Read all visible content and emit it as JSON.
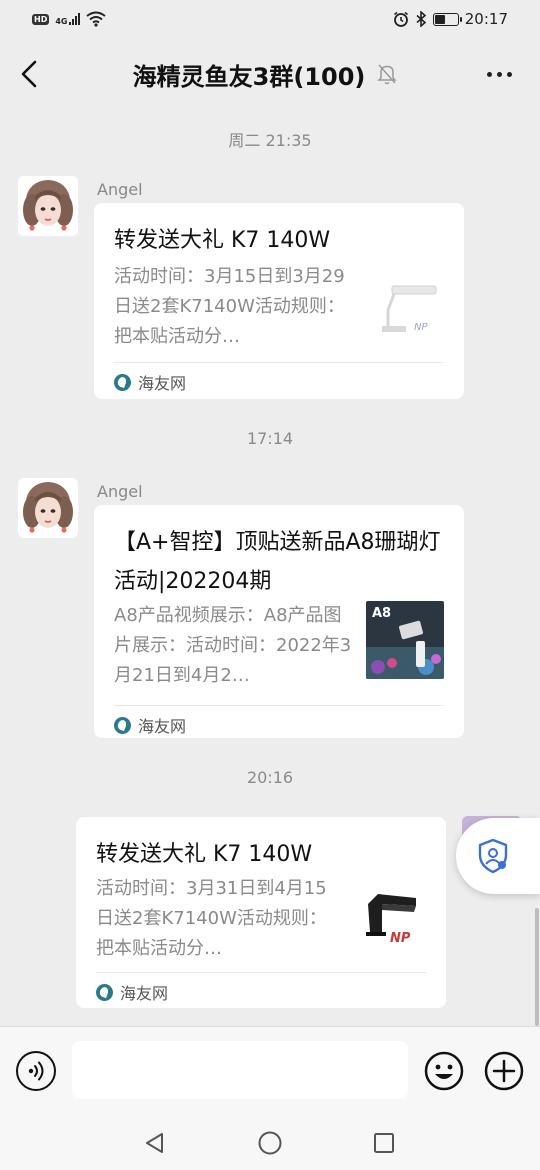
{
  "status_bar": {
    "hd": "HD",
    "network": "4G",
    "time": "20:17"
  },
  "header": {
    "title": "海精灵鱼友3群(100)",
    "icons": [
      "back-arrow-icon",
      "mute-bell-icon",
      "more-icon"
    ]
  },
  "messages": [
    {
      "time": "周二 21:35",
      "sender": "Angel",
      "title": "转发送大礼  K7 140W",
      "description": "活动时间：3月15日到3月29日送2套K7140W活动规则：把本贴活动分…",
      "source": "海友网",
      "thumbnail": "aquarium-light-white-image"
    },
    {
      "time": "17:14",
      "sender": "Angel",
      "title": "【A+智控】顶贴送新品A8珊瑚灯活动|202204期",
      "description": "A8产品视频展示：A8产品图片展示：活动时间：2022年3月21日到4月2…",
      "source": "海友网",
      "thumbnail": "a8-coral-light-poster",
      "thumbnail_label": "A8"
    },
    {
      "time": "20:16",
      "title": "转发送大礼 K7 140W",
      "description": "活动时间：3月31日到4月15日送2套K7140W活动规则：把本贴活动分…",
      "source": "海友网",
      "thumbnail": "aquarium-light-black-image"
    }
  ],
  "input_bar": {
    "placeholder": "",
    "icons": [
      "voice-icon",
      "emoji-icon",
      "plus-icon"
    ]
  },
  "nav_bar": {
    "icons": [
      "back-triangle-icon",
      "home-circle-icon",
      "recents-square-icon"
    ]
  },
  "colors": {
    "background": "#ededed",
    "card": "#ffffff",
    "muted_text": "#8a8a8a",
    "accent_blue": "#3a6fd8"
  }
}
